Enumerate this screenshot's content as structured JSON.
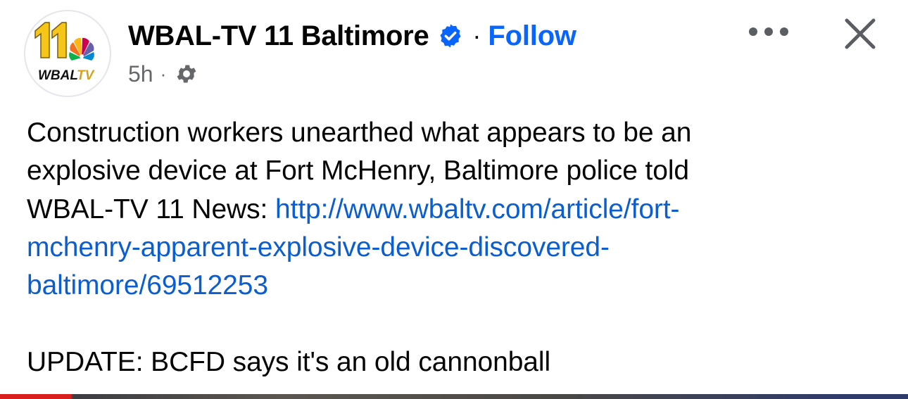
{
  "post": {
    "page_name": "WBAL-TV 11 Baltimore",
    "separator": "·",
    "follow_label": "Follow",
    "timestamp": "5h",
    "meta_separator": "·",
    "avatar_logo_text": "WBALTV",
    "avatar_number": "11",
    "body": {
      "line1": "Construction workers unearthed what appears to be an",
      "line2": "explosive device at Fort McHenry, Baltimore police told",
      "line3_text": "WBAL-TV 11 News: ",
      "link_line1": "http://www.wbaltv.com/article/fort-",
      "link_line2": "mchenry-apparent-explosive-device-discovered-",
      "link_line3": "baltimore/69512253",
      "update": "UPDATE: BCFD says it's an old cannonball"
    }
  },
  "icons": {
    "verified": "verified-badge-icon",
    "privacy": "gear-icon",
    "more": "more-horizontal-icon",
    "close": "close-icon"
  },
  "colors": {
    "link": "#0a5ecf",
    "follow": "#0866ff",
    "verified": "#0866ff",
    "meta_gray": "#65676b",
    "logo_yellow": "#f5c518"
  }
}
